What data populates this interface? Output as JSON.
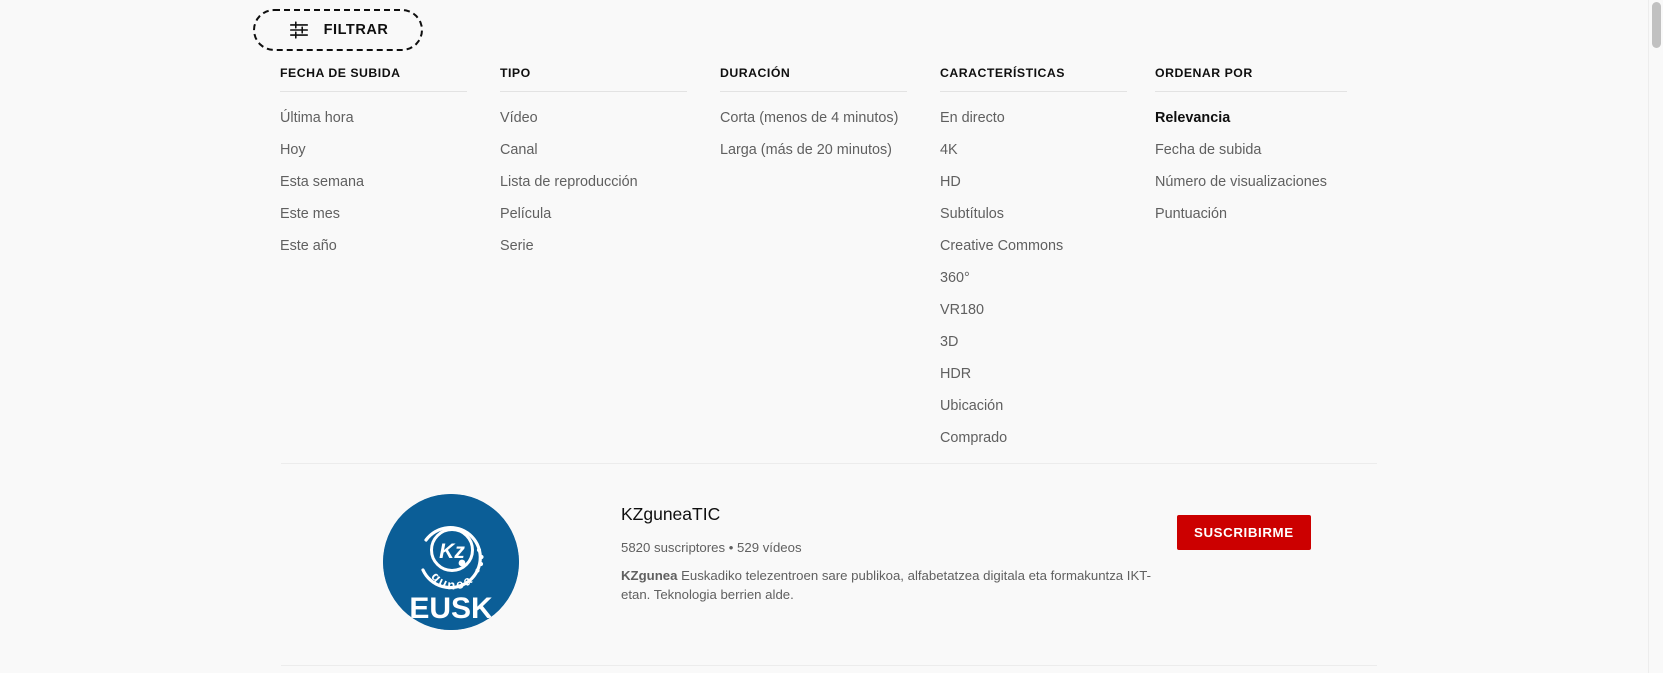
{
  "filter_button": {
    "label": "FILTRAR",
    "icon": "tune-sliders-icon"
  },
  "filter_columns": [
    {
      "key": "fecha_de_subida",
      "header": "FECHA DE SUBIDA",
      "items": [
        {
          "label": "Última hora",
          "selected": false
        },
        {
          "label": "Hoy",
          "selected": false
        },
        {
          "label": "Esta semana",
          "selected": false
        },
        {
          "label": "Este mes",
          "selected": false
        },
        {
          "label": "Este año",
          "selected": false
        }
      ]
    },
    {
      "key": "tipo",
      "header": "TIPO",
      "items": [
        {
          "label": "Vídeo",
          "selected": false
        },
        {
          "label": "Canal",
          "selected": false
        },
        {
          "label": "Lista de reproducción",
          "selected": false
        },
        {
          "label": "Película",
          "selected": false
        },
        {
          "label": "Serie",
          "selected": false
        }
      ]
    },
    {
      "key": "duracion",
      "header": "DURACIÓN",
      "items": [
        {
          "label": "Corta (menos de 4 minutos)",
          "selected": false
        },
        {
          "label": "Larga (más de 20 minutos)",
          "selected": false
        }
      ]
    },
    {
      "key": "caracteristicas",
      "header": "CARACTERÍSTICAS",
      "items": [
        {
          "label": "En directo",
          "selected": false
        },
        {
          "label": "4K",
          "selected": false
        },
        {
          "label": "HD",
          "selected": false
        },
        {
          "label": "Subtítulos",
          "selected": false
        },
        {
          "label": "Creative Commons",
          "selected": false
        },
        {
          "label": "360°",
          "selected": false
        },
        {
          "label": "VR180",
          "selected": false
        },
        {
          "label": "3D",
          "selected": false
        },
        {
          "label": "HDR",
          "selected": false
        },
        {
          "label": "Ubicación",
          "selected": false
        },
        {
          "label": "Comprado",
          "selected": false
        }
      ]
    },
    {
      "key": "ordenar_por",
      "header": "ORDENAR POR",
      "items": [
        {
          "label": "Relevancia",
          "selected": true
        },
        {
          "label": "Fecha de subida",
          "selected": false
        },
        {
          "label": "Número de visualizaciones",
          "selected": false
        },
        {
          "label": "Puntuación",
          "selected": false
        }
      ]
    }
  ],
  "channel": {
    "avatar_alt": "KZgunea EUSK logo",
    "avatar_logo_text": "KZ",
    "avatar_arc_text": "gunea",
    "avatar_bottom_text": "EUSK",
    "avatar_bg_color": "#0b5e97",
    "name": "KZguneaTIC",
    "meta": "5820 suscriptores • 529 vídeos",
    "description_bold": "KZgunea",
    "description_rest": " Euskadiko telezentroen sare publikoa, alfabetatzea digitala eta formakuntza IKT-etan. Teknologia berrien alde.",
    "subscribe_label": "SUSCRIBIRME",
    "subscribe_color": "#cc0000"
  }
}
